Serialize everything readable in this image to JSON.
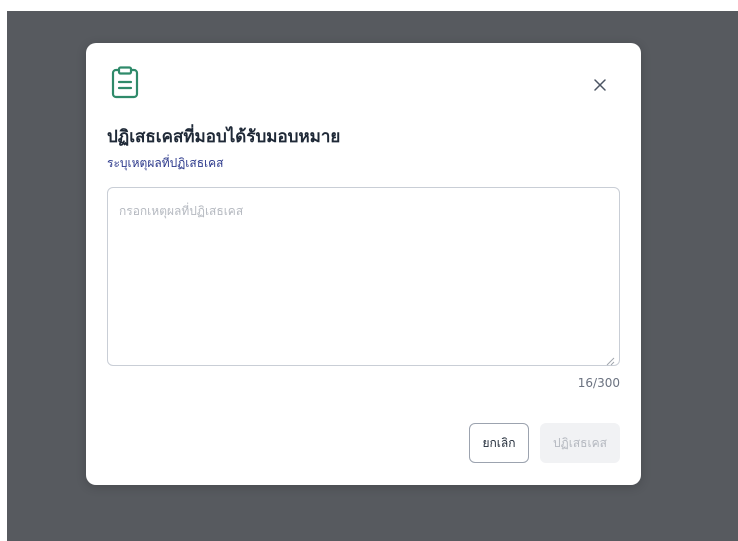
{
  "modal": {
    "title": "ปฏิเสธเคสที่มอบได้รับมอบหมาย",
    "subtitle": "ระบุเหตุผลที่ปฏิเสธเคส",
    "icon": "clipboard-icon",
    "icon_color": "#2f8a6a",
    "reason_input": {
      "placeholder": "กรอกเหตุผลที่ปฏิเสธเคส",
      "value": ""
    },
    "counter": "16/300",
    "cancel_label": "ยกเลิก",
    "reject_label": "ปฏิเสธเคส"
  },
  "colors": {
    "overlay": "#575a5f",
    "subtitle": "#2d3a8c",
    "disabled_button_bg": "#f1f2f4",
    "disabled_button_text": "#b5b9c0"
  }
}
